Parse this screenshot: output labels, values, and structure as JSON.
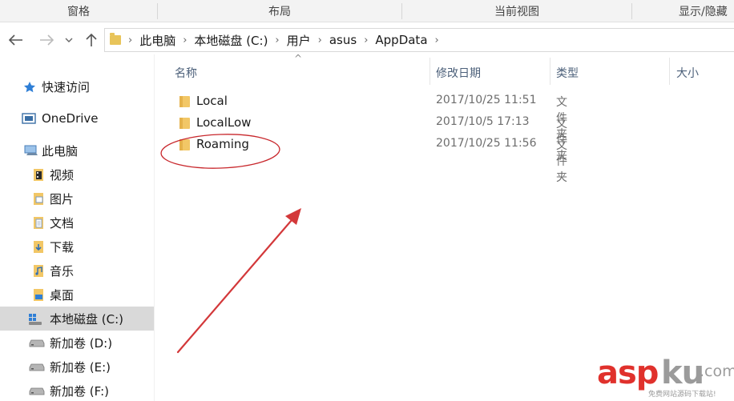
{
  "ribbon": {
    "groups": [
      "窗格",
      "布局",
      "当前视图",
      "显示/隐藏"
    ]
  },
  "nav": {
    "back_icon": "arrow-left-icon",
    "forward_icon": "arrow-right-icon",
    "recent_icon": "chevron-down-icon",
    "up_icon": "arrow-up-icon",
    "breadcrumbs": [
      "此电脑",
      "本地磁盘 (C:)",
      "用户",
      "asus",
      "AppData"
    ]
  },
  "sidebar": {
    "items": [
      {
        "label": "快速访问",
        "icon": "star-icon"
      },
      {
        "label": "OneDrive",
        "icon": "onedrive-icon"
      },
      {
        "label": "此电脑",
        "icon": "computer-icon"
      },
      {
        "label": "视频",
        "icon": "video-folder-icon"
      },
      {
        "label": "图片",
        "icon": "pictures-folder-icon"
      },
      {
        "label": "文档",
        "icon": "documents-folder-icon"
      },
      {
        "label": "下载",
        "icon": "downloads-folder-icon"
      },
      {
        "label": "音乐",
        "icon": "music-folder-icon"
      },
      {
        "label": "桌面",
        "icon": "desktop-folder-icon"
      },
      {
        "label": "本地磁盘 (C:)",
        "icon": "windows-drive-icon",
        "selected": true
      },
      {
        "label": "新加卷 (D:)",
        "icon": "drive-icon"
      },
      {
        "label": "新加卷 (E:)",
        "icon": "drive-icon"
      },
      {
        "label": "新加卷 (F:)",
        "icon": "drive-icon"
      }
    ]
  },
  "columns": {
    "name": "名称",
    "modified": "修改日期",
    "type": "类型",
    "size": "大小"
  },
  "files": [
    {
      "name": "Local",
      "modified": "2017/10/25 11:51",
      "type": "文件夹"
    },
    {
      "name": "LocalLow",
      "modified": "2017/10/5 17:13",
      "type": "文件夹"
    },
    {
      "name": "Roaming",
      "modified": "2017/10/25 11:56",
      "type": "文件夹"
    }
  ],
  "annotation": {
    "highlight_color": "#c8272c",
    "highlighted_item": "Roaming"
  },
  "watermark": {
    "brand_a": "asp",
    "brand_b": "ku",
    "brand_c": ".com",
    "subtitle": "免费网站源码下载站!"
  },
  "colors": {
    "ribbon_bg": "#f3f3f3",
    "selected_bg": "#d9d9d9",
    "folder": "#f2c766",
    "header_text": "#4c607a",
    "watermark_red": "#e0312c"
  }
}
